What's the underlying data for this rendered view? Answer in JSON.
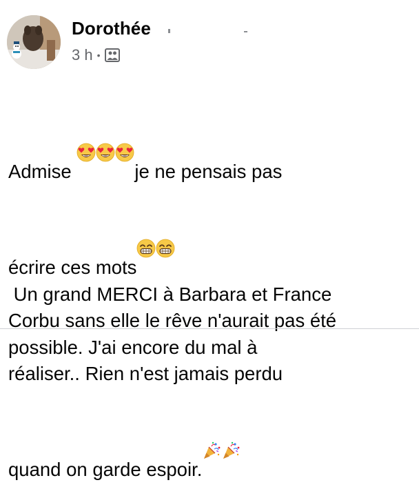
{
  "post": {
    "author_name": "Dorothée",
    "timestamp": "3 h",
    "separator": "•",
    "audience_icon": "friends-album-icon",
    "lines": [
      {
        "parts": [
          {
            "t": "Admise "
          },
          {
            "e": "heart-eyes"
          },
          {
            "e": "heart-eyes"
          },
          {
            "e": "heart-eyes"
          },
          {
            "t": "je ne pensais pas"
          }
        ]
      },
      {
        "parts": [
          {
            "t": "écrire ces mots"
          },
          {
            "e": "grin"
          },
          {
            "e": "grin"
          }
        ]
      },
      {
        "parts": [
          {
            "t": " Un grand MERCI à Barbara et France"
          }
        ]
      },
      {
        "parts": [
          {
            "t": "Corbu sans elle le rêve n'aurait pas été"
          }
        ]
      },
      {
        "parts": [
          {
            "t": "possible. J'ai encore du mal à"
          }
        ]
      },
      {
        "parts": [
          {
            "t": "réaliser.. Rien n'est jamais perdu"
          }
        ]
      },
      {
        "parts": [
          {
            "t": "quand on garde espoir."
          },
          {
            "e": "party-popper"
          },
          {
            "e": "party-popper"
          }
        ]
      }
    ]
  },
  "colors": {
    "text": "#050505",
    "meta": "#65676b",
    "divider": "#ced0d4"
  }
}
